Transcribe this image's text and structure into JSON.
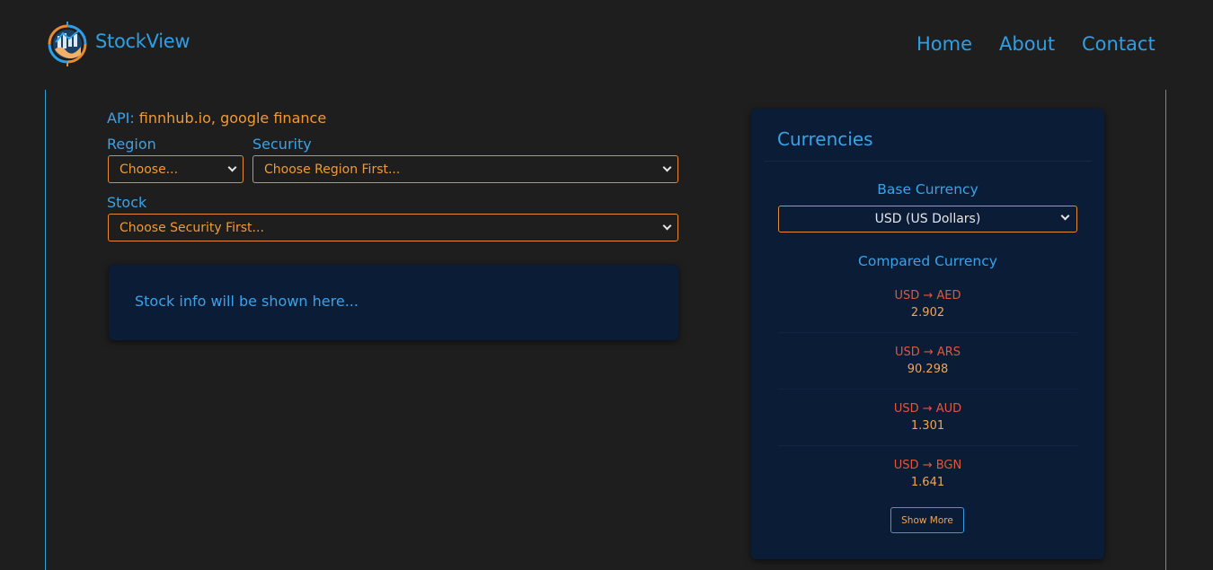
{
  "nav": {
    "brand": "StockView",
    "links": [
      "Home",
      "About",
      "Contact"
    ]
  },
  "api": {
    "label": "API:",
    "value": "finnhub.io, google finance"
  },
  "form": {
    "region_label": "Region",
    "region_value": "Choose...",
    "security_label": "Security",
    "security_value": "Choose Region First...",
    "stock_label": "Stock",
    "stock_value": "Choose Security First..."
  },
  "info": {
    "placeholder": "Stock info will be shown here..."
  },
  "currencies": {
    "title": "Currencies",
    "base_label": "Base Currency",
    "base_value": "USD (US Dollars)",
    "compared_label": "Compared Currency",
    "rates": [
      {
        "pair": "USD → AED",
        "value": "2.902"
      },
      {
        "pair": "USD → ARS",
        "value": "90.298"
      },
      {
        "pair": "USD → AUD",
        "value": "1.301"
      },
      {
        "pair": "USD → BGN",
        "value": "1.641"
      }
    ],
    "show_more": "Show More"
  },
  "colors": {
    "background": "#1e1e1e",
    "accent_blue": "#2e9fe6",
    "accent_orange": "#f19a35",
    "card": "#0a1c36",
    "pair_red": "#e0573f"
  }
}
